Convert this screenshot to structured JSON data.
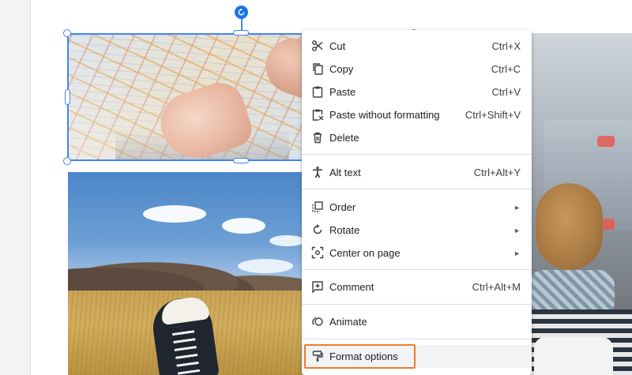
{
  "menu": {
    "items": [
      {
        "label": "Cut",
        "shortcut": "Ctrl+X",
        "icon": "scissors-icon"
      },
      {
        "label": "Copy",
        "shortcut": "Ctrl+C",
        "icon": "copy-icon"
      },
      {
        "label": "Paste",
        "shortcut": "Ctrl+V",
        "icon": "clipboard-icon"
      },
      {
        "label": "Paste without formatting",
        "shortcut": "Ctrl+Shift+V",
        "icon": "clipboard-plain-icon"
      },
      {
        "label": "Delete",
        "shortcut": "",
        "icon": "trash-icon"
      },
      {
        "label": "Alt text",
        "shortcut": "Ctrl+Alt+Y",
        "icon": "accessibility-icon"
      },
      {
        "label": "Order",
        "shortcut": "",
        "icon": "order-icon",
        "submenu": true
      },
      {
        "label": "Rotate",
        "shortcut": "",
        "icon": "rotate-icon",
        "submenu": true
      },
      {
        "label": "Center on page",
        "shortcut": "",
        "icon": "center-icon",
        "submenu": true
      },
      {
        "label": "Comment",
        "shortcut": "Ctrl+Alt+M",
        "icon": "add-comment-icon"
      },
      {
        "label": "Animate",
        "shortcut": "",
        "icon": "animate-icon"
      },
      {
        "label": "Format options",
        "shortcut": "",
        "icon": "format-paint-icon",
        "hovered": true
      }
    ],
    "submenu_arrow": "►"
  },
  "colors": {
    "selection": "#4285f4",
    "rotate_handle": "#1a73e8",
    "highlight": "#f07c2c",
    "menu_hover": "#f1f3f4"
  }
}
